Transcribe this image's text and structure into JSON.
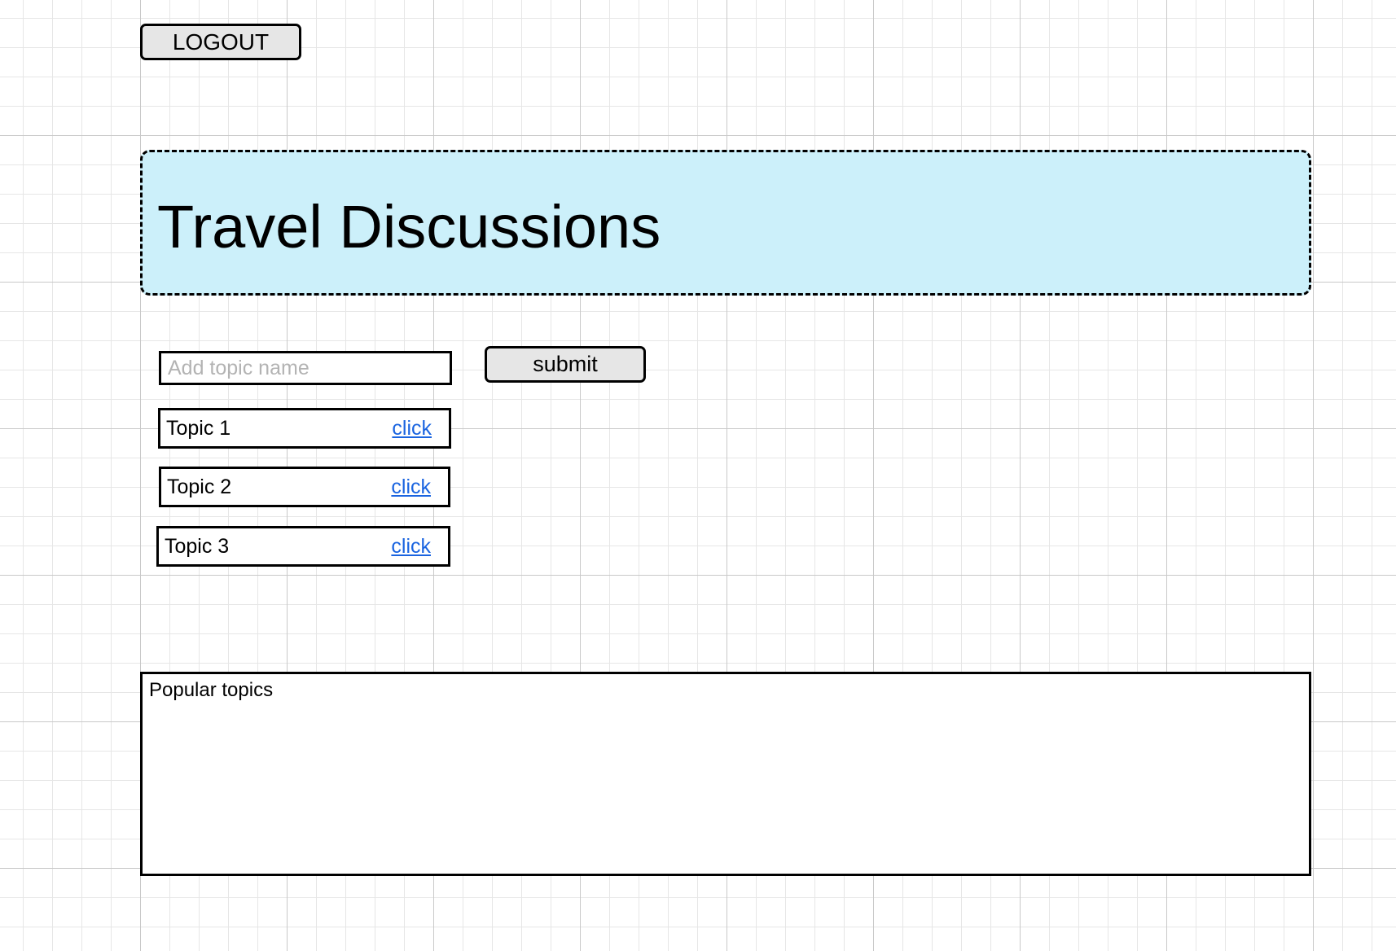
{
  "toolbar": {
    "logout_label": "LOGOUT"
  },
  "header": {
    "title": "Travel Discussions",
    "background_color": "#ccf0fa"
  },
  "topic_form": {
    "placeholder": "Add topic name",
    "value": "",
    "submit_label": "submit"
  },
  "topics": [
    {
      "name": "Topic 1",
      "link_label": "click"
    },
    {
      "name": "Topic 2",
      "link_label": "click"
    },
    {
      "name": "Topic 3",
      "link_label": "click"
    }
  ],
  "popular": {
    "label": "Popular topics"
  },
  "colors": {
    "button_fill": "#e6e6e6",
    "link": "#1a64e0",
    "placeholder_text": "#b3b3b3"
  }
}
